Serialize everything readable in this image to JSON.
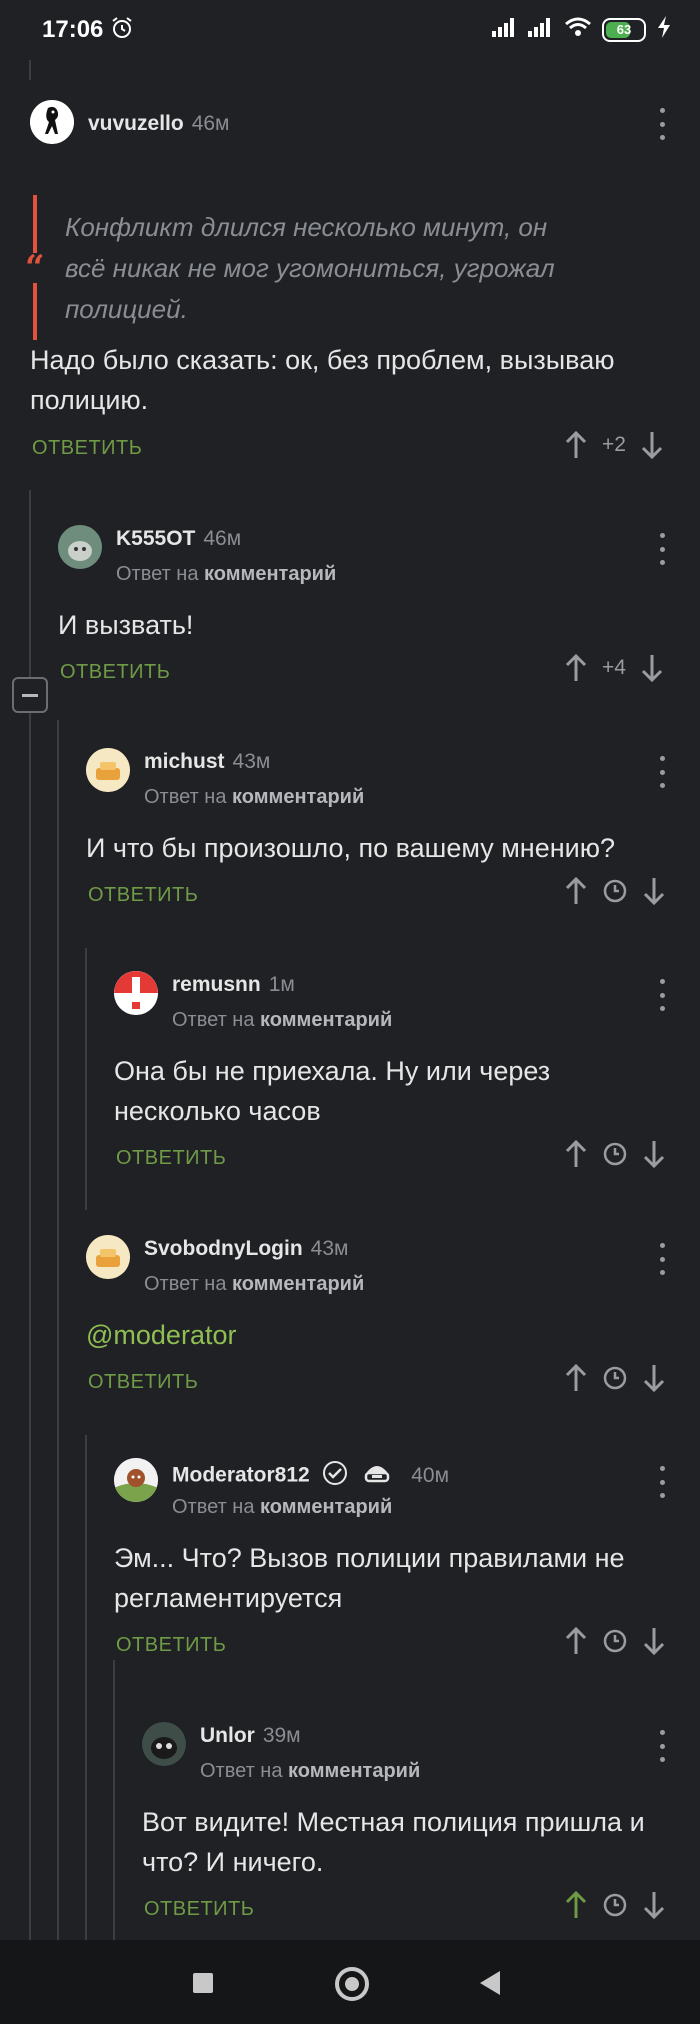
{
  "status_bar": {
    "time": "17:06",
    "battery": "63",
    "icons": [
      "alarm-icon",
      "signal-icon",
      "signal-icon",
      "wifi-icon",
      "battery-icon",
      "charging-icon"
    ]
  },
  "reply_label": "ОТВЕТИТЬ",
  "reply_to_prefix": "Ответ на",
  "reply_to_link": "комментарий",
  "comments": [
    {
      "user": "vuvuzello",
      "time": "46м",
      "quote": "Конфликт длился несколько минут, он всё никак не мог угомониться, угрожал полицией.",
      "text": "Надо было сказать: ок, без проблем, вызываю полицию.",
      "rating": "+2"
    },
    {
      "user": "K555OT",
      "time": "46м",
      "text": "И вызвать!",
      "rating": "+4"
    },
    {
      "user": "michust",
      "time": "43м",
      "text": "И что бы произошло, по вашему мнению?"
    },
    {
      "user": "remusnn",
      "time": "1м",
      "text": "Она бы не приехала. Ну или через несколько часов"
    },
    {
      "user": "SvobodnyLogin",
      "time": "43м",
      "text": "@moderator"
    },
    {
      "user": "Moderator812",
      "time": "40м",
      "text": "Эм... Что? Вызов полиции правилами не регламентируется"
    },
    {
      "user": "Unlor",
      "time": "39м",
      "text": "Вот видите! Местная полиция пришла и что? И ничего."
    }
  ],
  "colors": {
    "background": "#1f2124",
    "accent_green": "#6f9b46",
    "quote_red": "#e2533e",
    "upvoted_green": "#6f9b46"
  }
}
